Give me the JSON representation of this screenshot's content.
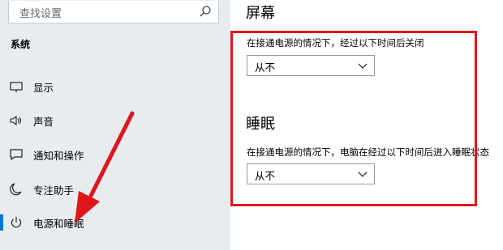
{
  "search": {
    "placeholder": "查找设置"
  },
  "sidebar": {
    "section": "系统",
    "items": [
      {
        "label": "显示",
        "icon": "display-icon"
      },
      {
        "label": "声音",
        "icon": "sound-icon"
      },
      {
        "label": "通知和操作",
        "icon": "notification-icon"
      },
      {
        "label": "专注助手",
        "icon": "moon-icon"
      },
      {
        "label": "电源和睡眠",
        "icon": "power-icon",
        "active": true
      }
    ]
  },
  "main": {
    "screen": {
      "heading": "屏幕",
      "description": "在接通电源的情况下，经过以下时间后关闭",
      "value": "从不"
    },
    "sleep": {
      "heading": "睡眠",
      "description": "在接通电源的情况下，电脑在经过以下时间后进入睡眠状态",
      "value": "从不"
    }
  },
  "colors": {
    "accent": "#0078d7",
    "annotation_red": "#e0161b",
    "sidebar_bg": "#e9ecef"
  }
}
